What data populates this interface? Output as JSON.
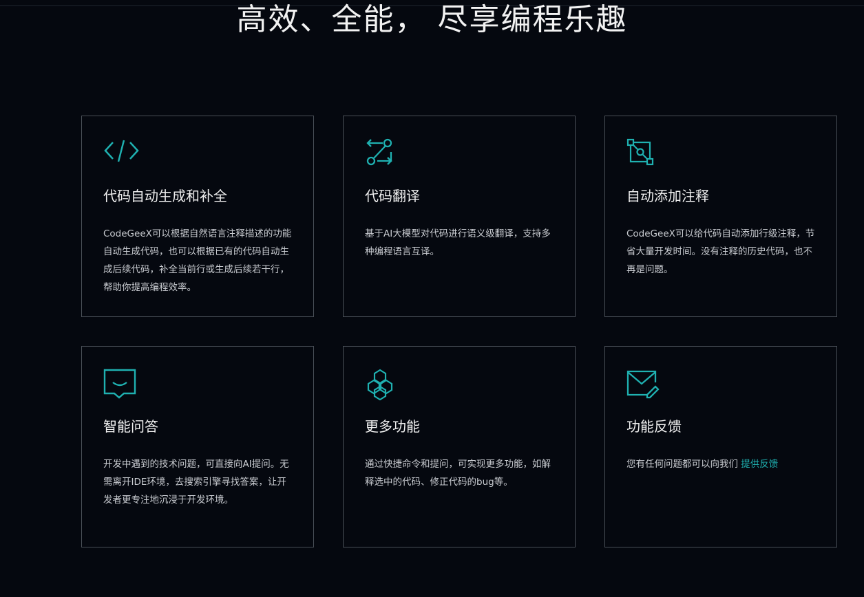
{
  "headline": "高效、全能， 尽享编程乐趣",
  "accent_color": "#1fb1b1",
  "features": [
    {
      "icon": "code-icon",
      "title": "代码自动生成和补全",
      "description": "CodeGeeX可以根据自然语言注释描述的功能自动生成代码，也可以根据已有的代码自动生成后续代码，补全当前行或生成后续若干行，帮助你提高编程效率。"
    },
    {
      "icon": "translate-icon",
      "title": "代码翻译",
      "description": "基于AI大模型对代码进行语义级翻译，支持多种编程语言互译。"
    },
    {
      "icon": "annotate-icon",
      "title": "自动添加注释",
      "description": "CodeGeeX可以给代码自动添加行级注释，节省大量开发时间。没有注释的历史代码，也不再是问题。"
    },
    {
      "icon": "chat-icon",
      "title": "智能问答",
      "description": "开发中遇到的技术问题，可直接向AI提问。无需离开IDE环境，去搜索引擎寻找答案，让开发者更专注地沉浸于开发环境。"
    },
    {
      "icon": "cubes-icon",
      "title": "更多功能",
      "description": "通过快捷命令和提问，可实现更多功能，如解释选中的代码、修正代码的bug等。"
    },
    {
      "icon": "mail-icon",
      "title": "功能反馈",
      "description": "您有任何问题都可以向我们 ",
      "link_label": "提供反馈"
    }
  ]
}
